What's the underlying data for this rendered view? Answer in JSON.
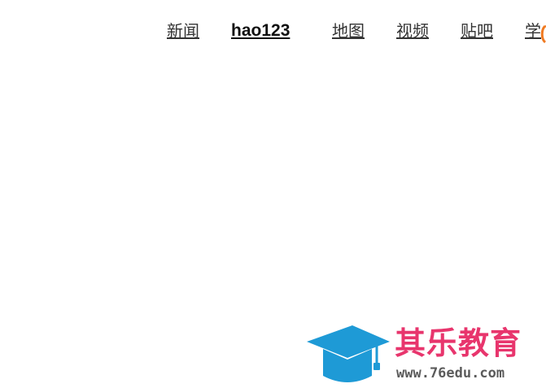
{
  "nav": {
    "items": [
      {
        "label": "新闻"
      },
      {
        "label": "hao123"
      },
      {
        "label": "地图"
      },
      {
        "label": "视频"
      },
      {
        "label": "贴吧"
      },
      {
        "label": "学"
      }
    ]
  },
  "watermark": {
    "title": "其乐教育",
    "url": "www.76edu.com",
    "title_color": "#e8356d",
    "cap_color": "#1e9ad6"
  }
}
